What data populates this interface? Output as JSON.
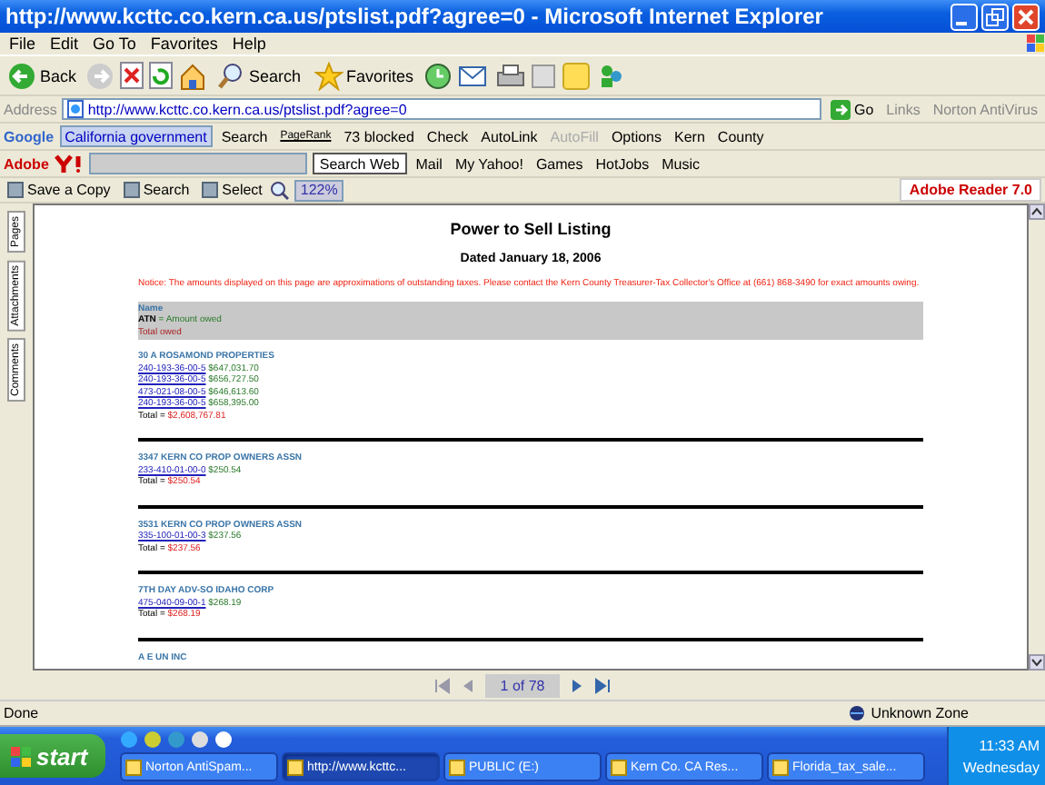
{
  "window": {
    "title": "http://www.kcttc.co.kern.ca.us/ptslist.pdf?agree=0 - Microsoft Internet Explorer"
  },
  "menu": [
    "File",
    "Edit",
    "Go To",
    "Favorites",
    "Help"
  ],
  "toolbar": {
    "buttons": [
      {
        "kind": "back",
        "label": "Back"
      },
      {
        "kind": "search",
        "label": "Search"
      },
      {
        "kind": "favorites",
        "label": "Favorites"
      }
    ]
  },
  "address": {
    "label": "Address",
    "value": "http://www.kcttc.co.kern.ca.us/ptslist.pdf?agree=0",
    "go": "Go",
    "links": "Links",
    "extra": "Norton AntiVirus"
  },
  "google_bar": {
    "logo": "Google",
    "query": "California government",
    "items": [
      {
        "label": "Search",
        "disabled": false
      },
      {
        "label": "PageRank",
        "disabled": false
      },
      {
        "label": "73 blocked",
        "disabled": false
      },
      {
        "label": "Check",
        "disabled": false
      },
      {
        "label": "AutoLink",
        "disabled": false
      },
      {
        "label": "AutoFill",
        "disabled": true
      },
      {
        "label": "Options",
        "disabled": false
      },
      {
        "label": "Kern",
        "disabled": false
      },
      {
        "label": "County",
        "disabled": false
      }
    ]
  },
  "yahoo_bar": {
    "logo": "Adobe",
    "search_button": "Search Web",
    "items": [
      "Mail",
      "My Yahoo!",
      "Games",
      "HotJobs",
      "Music"
    ]
  },
  "reader_toolbar": {
    "items": [
      "Save a Copy",
      "Search",
      "Select"
    ],
    "zoom": "122%",
    "logo": "Adobe Reader 7.0"
  },
  "side_tabs": [
    "Pages",
    "Attachments",
    "Comments"
  ],
  "document": {
    "title": "Power to Sell Listing",
    "date": "Dated January 18, 2006",
    "notice": "Notice: The amounts displayed on this page are approximations of outstanding taxes. Please contact the Kern County Treasurer-Tax Collector's Office at (661) 868-3490 for exact amounts owing.",
    "legend": {
      "name": "Name",
      "atn": "ATN",
      "atn_rest": "= Amount owed",
      "total": "Total owed"
    },
    "entries": [
      {
        "name": "30 A ROSAMOND PROPERTIES",
        "parcels": [
          {
            "atn": "240-193-36-00-5",
            "amount": "$647,031.70"
          },
          {
            "atn": "240-193-36-00-5",
            "amount": "$656,727.50"
          },
          {
            "atn": "473-021-08-00-5",
            "amount": "$646,613.60"
          },
          {
            "atn": "240-193-36-00-5",
            "amount": "$658,395.00"
          }
        ],
        "total_label": "Total =",
        "total": "$2,608,767.81"
      },
      {
        "name": "3347 KERN CO PROP OWNERS ASSN",
        "parcels": [
          {
            "atn": "233-410-01-00-0",
            "amount": "$250.54"
          }
        ],
        "total_label": "Total =",
        "total": "$250.54"
      },
      {
        "name": "3531 KERN CO PROP OWNERS ASSN",
        "parcels": [
          {
            "atn": "335-100-01-00-3",
            "amount": "$237.56"
          }
        ],
        "total_label": "Total =",
        "total": "$237.56"
      },
      {
        "name": "7TH DAY ADV-SO IDAHO CORP",
        "parcels": [
          {
            "atn": "475-040-09-00-1",
            "amount": "$268.19"
          }
        ],
        "total_label": "Total =",
        "total": "$268.19"
      },
      {
        "name": "A E UN INC"
      }
    ]
  },
  "pdf_nav": {
    "page": "1 of 78"
  },
  "status_bar": {
    "text": "Done",
    "zone": "Unknown Zone"
  },
  "taskbar": {
    "start": "start",
    "tasks": [
      {
        "label": "Norton AntiSpam...",
        "selected": false
      },
      {
        "label": "http://www.kcttc...",
        "selected": true
      },
      {
        "label": "PUBLIC (E:)",
        "selected": false
      },
      {
        "label": "Kern Co. CA Res...",
        "selected": false
      },
      {
        "label": "Florida_tax_sale...",
        "selected": false
      }
    ],
    "time": "11:33 AM",
    "day": "Wednesday"
  }
}
